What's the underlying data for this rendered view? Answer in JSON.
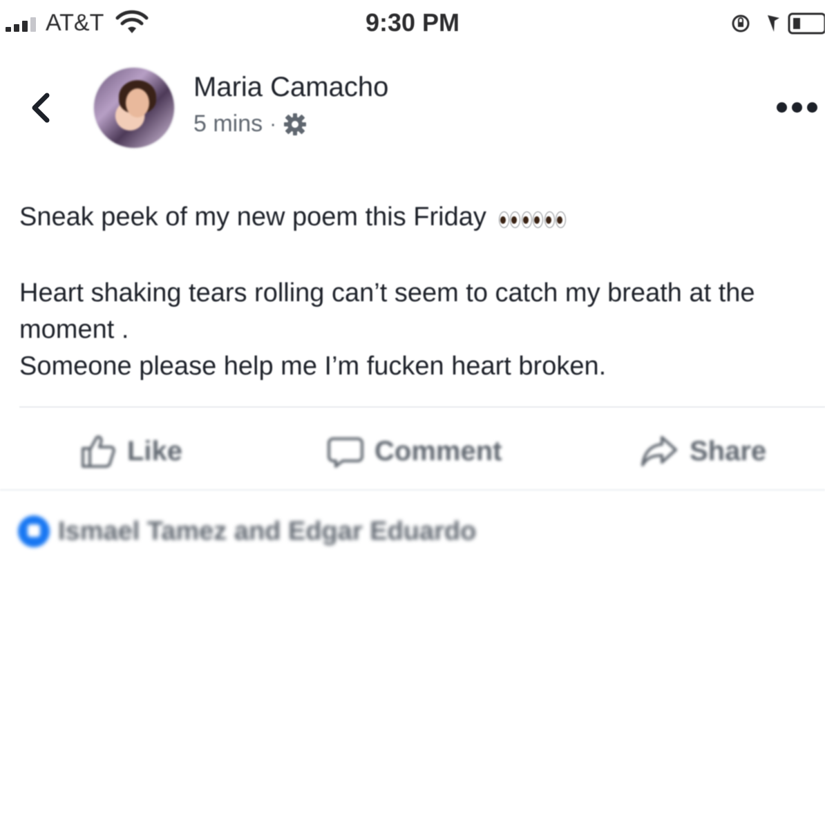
{
  "status_bar": {
    "carrier": "AT&T",
    "time": "9:30 PM",
    "icons": [
      "signal-icon",
      "wifi-icon",
      "orientation-lock-icon",
      "location-arrow-icon",
      "battery-icon"
    ]
  },
  "post": {
    "author": "Maria Camacho",
    "time_ago": "5 mins",
    "separator": "·",
    "audience_icon": "gear-icon",
    "lines": {
      "intro": "Sneak peek of my new poem this Friday",
      "line2": "Heart shaking tears rolling can’t seem to catch my breath at the moment .",
      "line3": "Someone please help me I’m fucken heart broken."
    },
    "emoji": "eyes-emoji"
  },
  "actions": {
    "like": "Like",
    "comment": "Comment",
    "share": "Share"
  },
  "reactions": {
    "text": "Ismael Tamez and Edgar Eduardo",
    "icon": "like-reaction-icon"
  },
  "colors": {
    "text": "#1d2129",
    "secondary": "#606770",
    "like_blue": "#1877f2",
    "divider": "#e9ebee"
  }
}
